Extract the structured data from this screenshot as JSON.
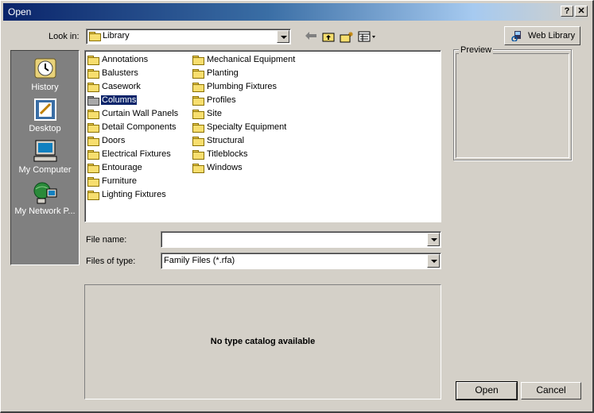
{
  "window": {
    "title": "Open",
    "help_label": "?",
    "close_label": "✕"
  },
  "toolbar": {
    "look_in_label": "Look in:",
    "look_in_value": "Library",
    "back_icon": "back-arrow-icon",
    "up_icon": "up-folder-icon",
    "new_folder_icon": "new-folder-icon",
    "views_icon": "views-menu-icon",
    "web_library_label": "Web Library"
  },
  "places": [
    {
      "label": "History",
      "icon": "history-icon"
    },
    {
      "label": "Desktop",
      "icon": "desktop-icon"
    },
    {
      "label": "My Computer",
      "icon": "my-computer-icon"
    },
    {
      "label": "My Network P...",
      "icon": "network-places-icon"
    }
  ],
  "files": {
    "col1": [
      "Annotations",
      "Balusters",
      "Casework",
      "Columns",
      "Curtain Wall Panels",
      "Detail Components",
      "Doors",
      "Electrical Fixtures",
      "Entourage",
      "Furniture",
      "Lighting Fixtures"
    ],
    "col2": [
      "Mechanical Equipment",
      "Planting",
      "Plumbing Fixtures",
      "Profiles",
      "Site",
      "Specialty Equipment",
      "Structural",
      "Titleblocks",
      "Windows"
    ],
    "selected": "Columns"
  },
  "form": {
    "file_name_label": "File name:",
    "file_name_value": "",
    "file_type_label": "Files of type:",
    "file_type_value": "Family Files (*.rfa)"
  },
  "preview": {
    "label": "Preview"
  },
  "catalog": {
    "message": "No type catalog available"
  },
  "buttons": {
    "open": "Open",
    "cancel": "Cancel"
  },
  "colors": {
    "face": "#d4d0c8",
    "title_start": "#0a246a",
    "selection": "#0a246a",
    "places_bg": "#808080"
  }
}
